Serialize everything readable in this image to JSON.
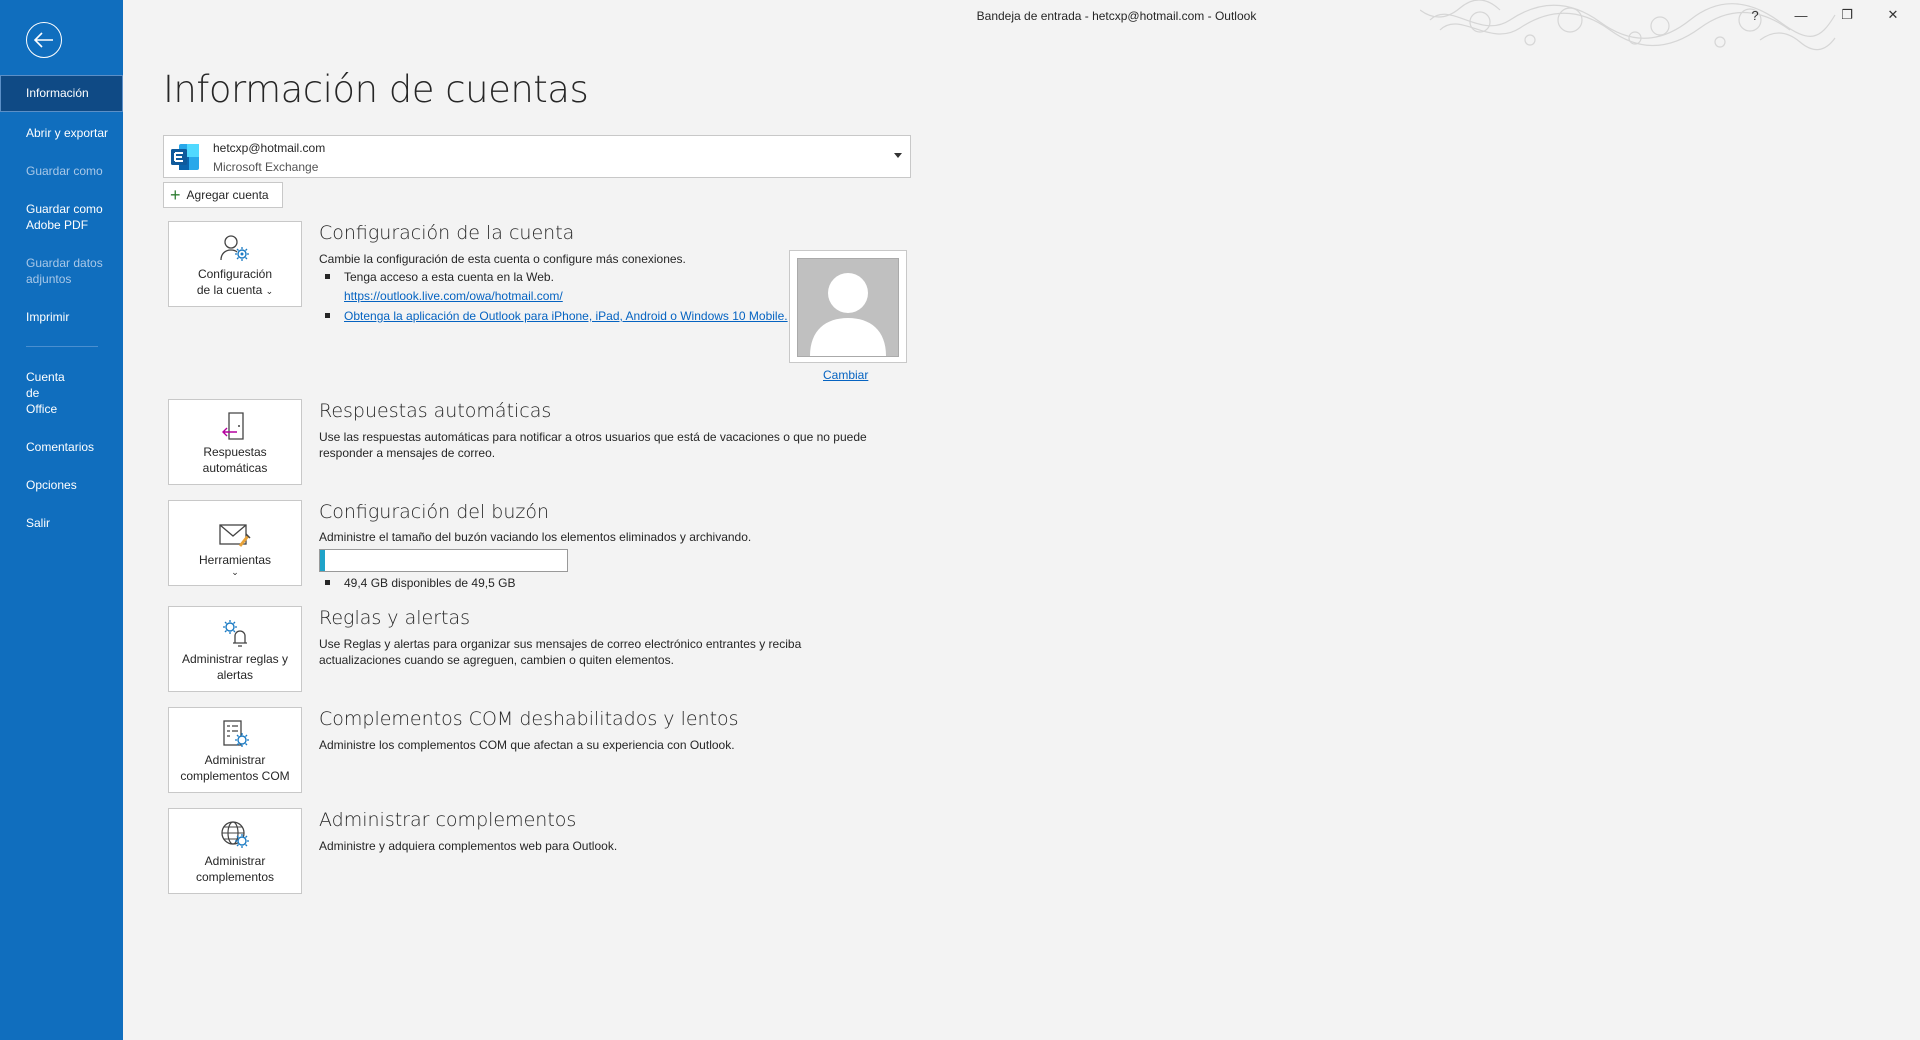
{
  "window": {
    "title": "Bandeja de entrada - hetcxp@hotmail.com  -  Outlook",
    "help_label": "?",
    "minimize_label": "—",
    "restore_label": "❐",
    "close_label": "✕"
  },
  "sidebar": {
    "items": [
      {
        "label": "Información",
        "state": "active"
      },
      {
        "label": "Abrir y exportar",
        "state": "enabled"
      },
      {
        "label": "Guardar como",
        "state": "disabled"
      },
      {
        "label": "Guardar como Adobe PDF",
        "state": "enabled"
      },
      {
        "label": "Guardar datos adjuntos",
        "state": "disabled"
      },
      {
        "label": "Imprimir",
        "state": "enabled"
      },
      {
        "label": "Cuenta de Office",
        "state": "enabled"
      },
      {
        "label": "Comentarios",
        "state": "enabled"
      },
      {
        "label": "Opciones",
        "state": "enabled"
      },
      {
        "label": "Salir",
        "state": "enabled"
      }
    ]
  },
  "page": {
    "title": "Información de cuentas"
  },
  "account": {
    "email": "hetcxp@hotmail.com",
    "type": "Microsoft Exchange",
    "add_label": "Agregar cuenta"
  },
  "sections": {
    "account_settings": {
      "tile_line1": "Configuración",
      "tile_line2": "de la cuenta",
      "title": "Configuración de la cuenta",
      "desc": "Cambie la configuración de esta cuenta o configure más conexiones.",
      "bullet1": "Tenga acceso a esta cuenta en la Web.",
      "link1": "https://outlook.live.com/owa/hotmail.com/",
      "link2": "Obtenga la aplicación de Outlook para iPhone, iPad, Android o Windows 10 Mobile.",
      "change_label": "Cambiar"
    },
    "auto_replies": {
      "tile_line1": "Respuestas",
      "tile_line2": "automáticas",
      "title": "Respuestas automáticas",
      "desc": "Use las respuestas automáticas para notificar a otros usuarios que está de vacaciones o que no puede responder a mensajes de correo."
    },
    "mailbox": {
      "tile_line1": "Herramientas",
      "title": "Configuración del buzón",
      "desc": "Administre el tamaño del buzón vaciando los elementos eliminados y archivando.",
      "usage_text": "49,4 GB disponibles de 49,5 GB",
      "used_fraction": 0.02
    },
    "rules": {
      "tile_line1": "Administrar reglas y",
      "tile_line2": "alertas",
      "title": "Reglas y alertas",
      "desc": "Use Reglas y alertas para organizar sus mensajes de correo electrónico entrantes y reciba actualizaciones cuando se agreguen, cambien o quiten elementos."
    },
    "com_addins": {
      "tile_line1": "Administrar",
      "tile_line2": "complementos COM",
      "title": "Complementos COM deshabilitados y lentos",
      "desc": "Administre los complementos COM que afectan a su experiencia con Outlook."
    },
    "addins": {
      "tile_line1": "Administrar",
      "tile_line2": "complementos",
      "title": "Administrar complementos",
      "desc": "Administre y adquiera complementos web para Outlook."
    }
  },
  "colors": {
    "sidebar_bg": "#106ebe",
    "sidebar_active": "#0f4a85",
    "link": "#0563c1",
    "progress": "#1fa3c9"
  }
}
